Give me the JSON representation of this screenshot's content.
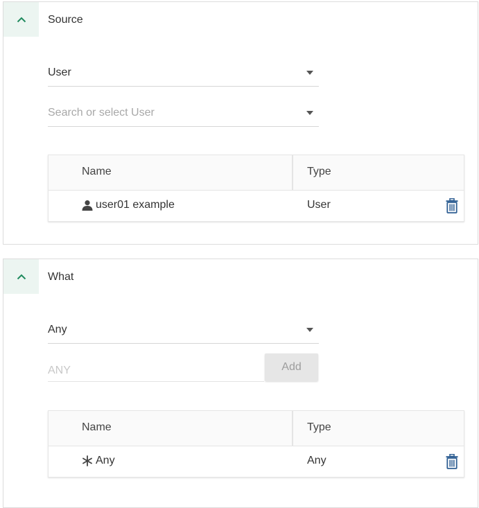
{
  "colors": {
    "accent": "#1f8a5e",
    "delete": "#2f5f93"
  },
  "source": {
    "title": "Source",
    "type_select": {
      "value": "User"
    },
    "search_select": {
      "placeholder": "Search or select User"
    },
    "table": {
      "headers": {
        "name": "Name",
        "type": "Type"
      },
      "rows": [
        {
          "icon": "person-icon",
          "name": "user01 example",
          "type": "User"
        }
      ]
    }
  },
  "what": {
    "title": "What",
    "type_select": {
      "value": "Any"
    },
    "input": {
      "placeholder": "ANY"
    },
    "add_label": "Add",
    "table": {
      "headers": {
        "name": "Name",
        "type": "Type"
      },
      "rows": [
        {
          "icon": "asterisk-icon",
          "name": "Any",
          "type": "Any"
        }
      ]
    }
  }
}
